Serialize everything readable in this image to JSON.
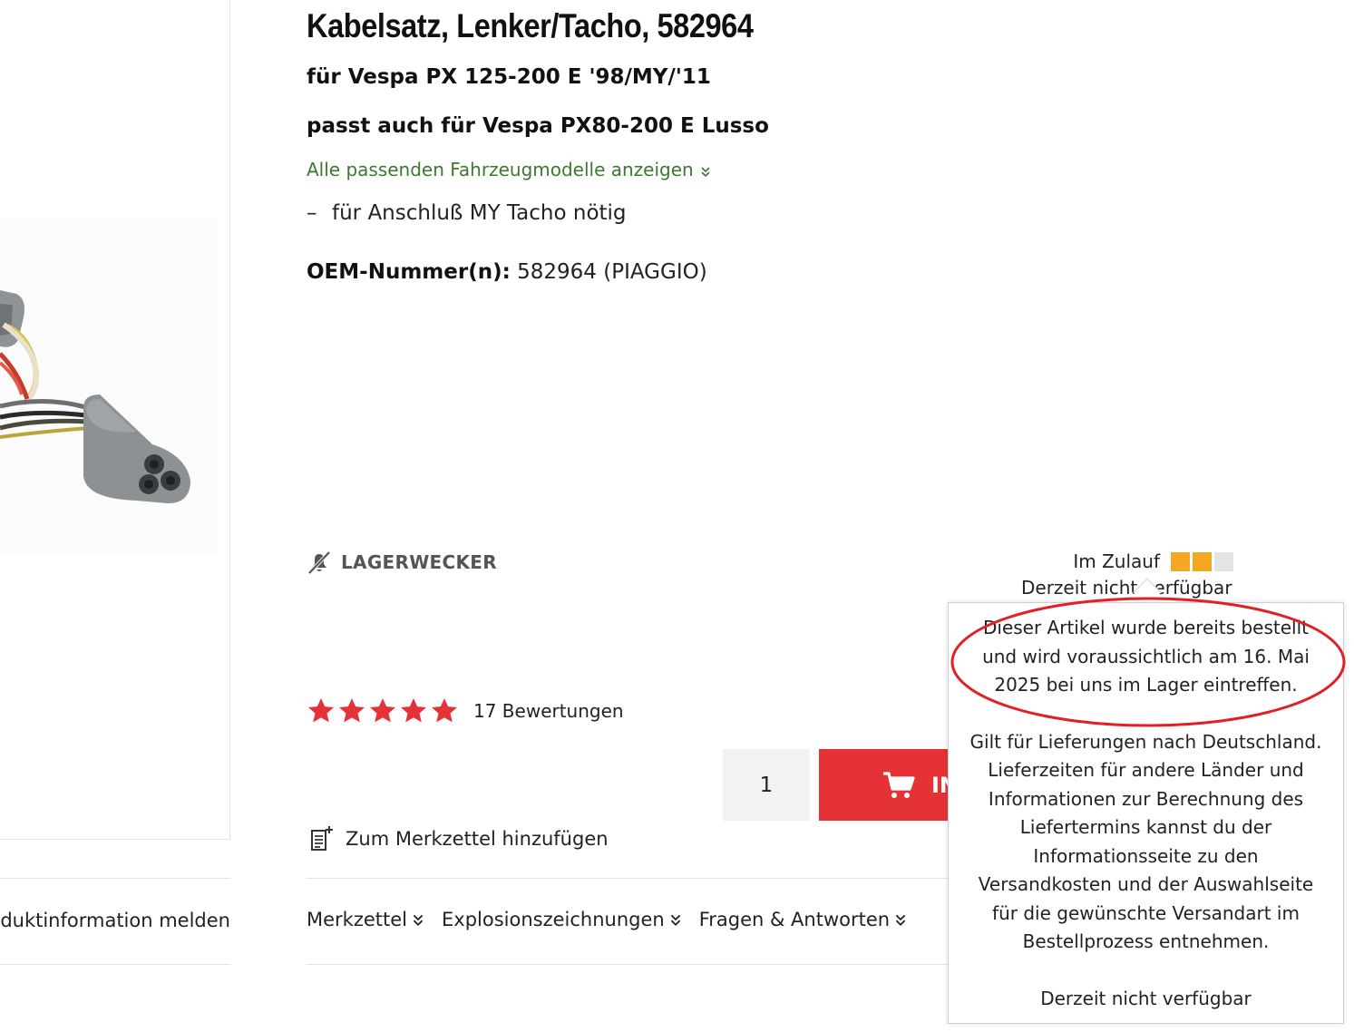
{
  "product": {
    "title": "Kabelsatz, Lenker/Tacho, 582964",
    "fits_primary": "für Vespa PX 125-200 E '98/MY/'11",
    "fits_also": "passt auch für Vespa PX80-200 E Lusso",
    "show_models_link": "Alle passenden Fahrzeugmodelle anzeigen",
    "feature_dash": "–",
    "feature_text": "für Anschluß MY Tacho nötig",
    "oem_label": "OEM-Nummer(n):",
    "oem_value": "582964 (PIAGGIO)"
  },
  "stock_alert": {
    "label": "LAGERWECKER"
  },
  "stock": {
    "status_label": "Im Zulauf",
    "availability": "Derzeit nicht verfügbar",
    "level_filled": 2,
    "level_total": 3,
    "colors": {
      "filled": "#f5a623",
      "empty": "#e4e4e4"
    }
  },
  "rating": {
    "stars": 5,
    "count_label": "17 Bewertungen",
    "star_color": "#e53237"
  },
  "purchase": {
    "quantity": "1",
    "cart_button_text": "IN",
    "cart_color": "#e53237"
  },
  "wishlist": {
    "label": "Zum Merkzettel hinzufügen"
  },
  "left_panel": {
    "report_link": "Produktinformation melden"
  },
  "tabs": [
    {
      "label": "Merkzettel"
    },
    {
      "label": "Explosionszeichnungen"
    },
    {
      "label": "Fragen & Antworten"
    }
  ],
  "tooltip": {
    "line1": "Dieser Artikel wurde bereits bestellt",
    "line2": "und wird voraussichtlich am 16. Mai",
    "line3": "2025 bei uns im Lager eintreffen.",
    "para2": [
      "Gilt für Lieferungen nach Deutschland.",
      "Lieferzeiten für andere Länder und",
      "Informationen zur Berechnung des",
      "Liefertermins kannst du der",
      "Informationsseite zu den",
      "Versandkosten und der Auswahlseite",
      "für die gewünschte Versandart im",
      "Bestellprozess entnehmen."
    ],
    "footer": "Derzeit nicht verfügbar",
    "annotation_color": "#e31e24"
  }
}
